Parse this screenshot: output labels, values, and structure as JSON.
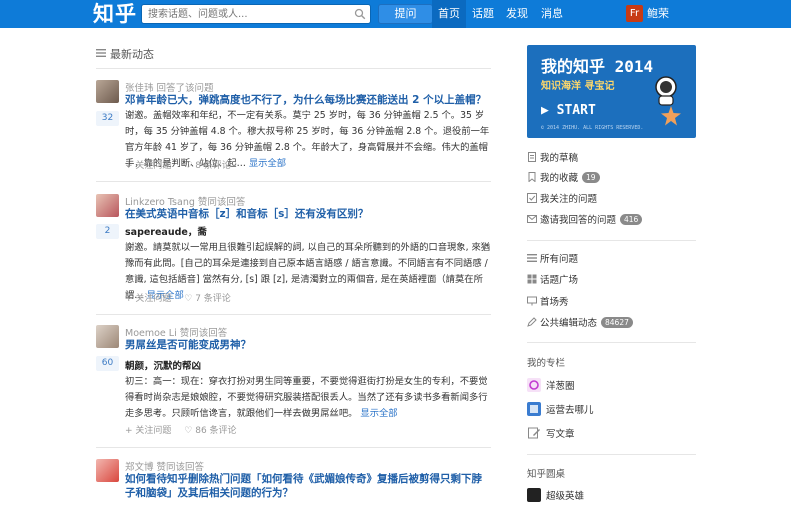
{
  "header": {
    "logo": "知乎",
    "search_placeholder": "搜索话题、问题或人...",
    "ask_label": "提问",
    "nav": [
      "首页",
      "话题",
      "发现",
      "消息"
    ],
    "avatar_text": "Fr",
    "username": "鲍荣"
  },
  "feed": {
    "title": "最新动态",
    "items": [
      {
        "actor": "张佳玮",
        "action": "回答了该问题",
        "question": "邓肯年龄已大，弹跳高度也不行了，为什么每场比赛还能送出 2 个以上盖帽？",
        "votes": "32",
        "answer_author": "",
        "answer": "谢邀。盖帽效率和年纪，不一定有关系。莫宁 25 岁时，每 36 分钟盖帽 2.5 个。35 岁时，每 35 分钟盖帽 4.8 个。穆大叔号称 25 岁时，每 36 分钟盖帽 2.8 个。退役前一年官方年龄 41 岁了，每 36 分钟盖帽 2.8 个。年龄大了，身高臂展并不会缩。伟大的盖帽手，靠的是判断、站位、起…",
        "more": "显示全部",
        "follow": "+ 关注问题",
        "comments": "8 条评论"
      },
      {
        "actor": "Linkzero Tsang",
        "action": "赞同该回答",
        "question": "在美式英语中音标［z］和音标［s］还有没有区别？",
        "votes": "2",
        "answer_author": "sapereaude，喬",
        "answer": "謝邀。請莫就以一常用且很難引起誤解的詞, 以自己的耳朵所聽到的外語的口音現象, 來猶豫而有此問。[自己的耳朵是連接到自己原本語言語感 / 語言意識。不同語言有不同語感 / 意識, 這包括語音] 當然有分, [s] 跟 [z], 是清濁對立的兩個音, 是在英語裡面（請莫在所謂…",
        "more": "显示全部",
        "follow": "+ 关注问题",
        "comments": "7 条评论"
      },
      {
        "actor": "Moemoe Li",
        "action": "赞同该回答",
        "question": "男屌丝是否可能变成男神？",
        "votes": "60",
        "answer_author": "朝颜，沉默的帮凶",
        "answer": "初三：高一：现在：穿衣打扮对男生同等重要，不要觉得逛街打扮是女生的专利，不要觉得看时尚杂志是娘娘腔，不要觉得研究服装搭配很丢人。当然了还有多读书多看新闻多行走多思考。只顾听信谗言，就跟他们一样去做男屌丝吧。",
        "more": "显示全部",
        "follow": "+ 关注问题",
        "comments": "86 条评论"
      },
      {
        "actor": "郑文博",
        "action": "赞同该回答",
        "question": "如何看待知乎删除热门问题「如何看待《武媚娘传奇》复播后被剪得只剩下脖子和脑袋」及其后相关问题的行为？",
        "votes": "",
        "answer_author": "",
        "answer": "",
        "more": "",
        "follow": "",
        "comments": ""
      }
    ]
  },
  "sidebar": {
    "banner": {
      "title": "我的知乎 2014",
      "subtitle": "知识海洋 寻宝记",
      "start": "START",
      "footer": "© 2014 ZHIHU. ALL RIGHTS RESERVED."
    },
    "group1": [
      {
        "label": "我的草稿",
        "badge": ""
      },
      {
        "label": "我的收藏",
        "badge": "19"
      },
      {
        "label": "我关注的问题",
        "badge": ""
      },
      {
        "label": "邀请我回答的问题",
        "badge": "416"
      }
    ],
    "group2": [
      {
        "label": "所有问题",
        "badge": ""
      },
      {
        "label": "话题广场",
        "badge": ""
      },
      {
        "label": "首场秀",
        "badge": ""
      },
      {
        "label": "公共编辑动态",
        "badge": "84627"
      }
    ],
    "columns_heading": "我的专栏",
    "columns": [
      "洋葱圈",
      "运营去哪儿",
      "写文章"
    ],
    "roundtable_heading": "知乎圆桌",
    "roundtable_item": "超级英雄"
  },
  "colors": {
    "topbar": "#0e7bd8",
    "link": "#1f5fa8",
    "banner": "#1c6fbd"
  }
}
